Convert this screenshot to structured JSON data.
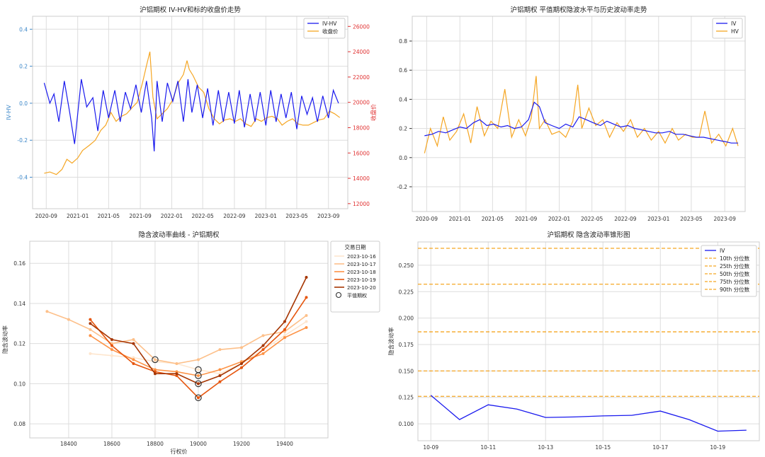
{
  "chart_data": [
    {
      "type": "line",
      "title": "沪铝期权 IV-HV和标的收盘价走势",
      "xlabel": "",
      "ylabel": "IV-HV",
      "y2label": "收盘价",
      "x_ticks": [
        "2020-09",
        "2021-01",
        "2021-05",
        "2021-09",
        "2022-01",
        "2022-05",
        "2022-09",
        "2023-01",
        "2023-05",
        "2023-09"
      ],
      "ylim": [
        -0.57,
        0.47
      ],
      "y_ticks": [
        "-0.4",
        "-0.2",
        "0.0",
        "0.2",
        "0.4"
      ],
      "y2lim": [
        11600,
        26800
      ],
      "y2_ticks": [
        "12000",
        "14000",
        "16000",
        "18000",
        "20000",
        "22000",
        "24000",
        "26000"
      ],
      "legend": "top-right",
      "grid": true,
      "colors": {
        "IV-HV": "#1a1aee",
        "收盘价": "#f5a623",
        "left_axis": "#3a86c8",
        "right_axis": "#e03030"
      },
      "series": [
        {
          "name": "IV-HV",
          "axis": "left",
          "x": [
            "2020-08-24",
            "2020-09-15",
            "2020-10-01",
            "2020-10-20",
            "2020-11-10",
            "2020-12-01",
            "2020-12-20",
            "2021-01-15",
            "2021-02-05",
            "2021-03-01",
            "2021-03-20",
            "2021-04-10",
            "2021-05-01",
            "2021-05-25",
            "2021-06-15",
            "2021-07-05",
            "2021-07-25",
            "2021-08-15",
            "2021-09-05",
            "2021-09-25",
            "2021-10-15",
            "2021-10-25",
            "2021-11-05",
            "2021-11-25",
            "2021-12-15",
            "2022-01-05",
            "2022-01-25",
            "2022-02-15",
            "2022-03-05",
            "2022-03-20",
            "2022-04-10",
            "2022-05-01",
            "2022-05-20",
            "2022-06-10",
            "2022-07-01",
            "2022-07-20",
            "2022-08-10",
            "2022-09-01",
            "2022-09-20",
            "2022-10-10",
            "2022-11-01",
            "2022-11-20",
            "2022-12-10",
            "2023-01-01",
            "2023-01-20",
            "2023-02-10",
            "2023-03-01",
            "2023-03-20",
            "2023-04-10",
            "2023-05-01",
            "2023-05-20",
            "2023-06-10",
            "2023-07-01",
            "2023-07-20",
            "2023-08-10",
            "2023-09-01",
            "2023-09-20",
            "2023-10-10"
          ],
          "values": [
            0.11,
            0.0,
            0.05,
            -0.1,
            0.12,
            -0.05,
            -0.22,
            0.13,
            -0.02,
            0.03,
            -0.15,
            0.07,
            -0.08,
            0.07,
            -0.1,
            0.06,
            -0.03,
            0.1,
            -0.05,
            0.12,
            -0.08,
            -0.26,
            0.12,
            -0.1,
            0.11,
            0.01,
            0.12,
            -0.1,
            0.13,
            -0.05,
            0.1,
            -0.08,
            0.08,
            -0.12,
            0.07,
            -0.1,
            0.06,
            -0.11,
            0.07,
            -0.13,
            0.05,
            -0.1,
            0.06,
            -0.12,
            0.07,
            -0.1,
            0.05,
            -0.08,
            0.06,
            -0.14,
            0.04,
            -0.06,
            0.03,
            -0.1,
            0.04,
            -0.08,
            0.07,
            0.0
          ]
        },
        {
          "name": "收盘价",
          "axis": "right",
          "x": [
            "2020-08-24",
            "2020-09-15",
            "2020-10-10",
            "2020-11-01",
            "2020-11-20",
            "2020-12-10",
            "2021-01-01",
            "2021-01-20",
            "2021-02-15",
            "2021-03-10",
            "2021-04-01",
            "2021-04-20",
            "2021-05-10",
            "2021-05-30",
            "2021-06-20",
            "2021-07-10",
            "2021-08-01",
            "2021-08-20",
            "2021-09-10",
            "2021-09-25",
            "2021-10-08",
            "2021-10-20",
            "2021-11-05",
            "2021-11-25",
            "2021-12-15",
            "2022-01-05",
            "2022-01-25",
            "2022-02-15",
            "2022-03-01",
            "2022-03-10",
            "2022-03-25",
            "2022-04-15",
            "2022-05-05",
            "2022-05-25",
            "2022-06-15",
            "2022-07-05",
            "2022-07-25",
            "2022-08-15",
            "2022-09-05",
            "2022-09-25",
            "2022-10-15",
            "2022-11-05",
            "2022-11-25",
            "2022-12-15",
            "2023-01-05",
            "2023-01-25",
            "2023-02-15",
            "2023-03-05",
            "2023-03-25",
            "2023-04-15",
            "2023-05-05",
            "2023-05-25",
            "2023-06-15",
            "2023-07-05",
            "2023-07-25",
            "2023-08-15",
            "2023-09-05",
            "2023-09-25",
            "2023-10-15"
          ],
          "values": [
            14400,
            14500,
            14300,
            14700,
            15500,
            15200,
            15600,
            16200,
            16600,
            17000,
            17800,
            18200,
            19200,
            18500,
            18900,
            19100,
            19600,
            20000,
            21600,
            22900,
            24000,
            20400,
            18700,
            19100,
            19500,
            20200,
            21500,
            22200,
            23300,
            22600,
            22100,
            21200,
            20800,
            19500,
            18700,
            18300,
            18600,
            18700,
            18500,
            18700,
            18300,
            18100,
            18700,
            18500,
            18800,
            18900,
            18700,
            18200,
            18500,
            18700,
            18300,
            18200,
            18200,
            18400,
            18600,
            18700,
            19300,
            19100,
            18800
          ]
        }
      ]
    },
    {
      "type": "line",
      "title": "沪铝期权 平值期权隐波水平与历史波动率走势",
      "xlabel": "",
      "ylabel": "",
      "x_ticks": [
        "2020-09",
        "2021-01",
        "2021-05",
        "2021-09",
        "2022-01",
        "2022-05",
        "2022-09",
        "2023-01",
        "2023-05",
        "2023-09"
      ],
      "ylim": [
        -0.37,
        0.97
      ],
      "y_ticks": [
        "-0.2",
        "0.0",
        "0.2",
        "0.4",
        "0.6",
        "0.8"
      ],
      "legend": "top-right",
      "grid": true,
      "colors": {
        "IV": "#1a1aee",
        "HV": "#f5a623"
      },
      "series": [
        {
          "name": "IV",
          "x": [
            "2020-08-24",
            "2020-09-20",
            "2020-10-15",
            "2020-11-10",
            "2020-12-05",
            "2021-01-01",
            "2021-01-25",
            "2021-02-20",
            "2021-03-15",
            "2021-04-10",
            "2021-05-05",
            "2021-06-01",
            "2021-06-25",
            "2021-07-20",
            "2021-08-15",
            "2021-09-10",
            "2021-10-01",
            "2021-10-20",
            "2021-11-10",
            "2021-12-05",
            "2022-01-01",
            "2022-01-25",
            "2022-02-20",
            "2022-03-15",
            "2022-04-10",
            "2022-05-05",
            "2022-06-01",
            "2022-06-25",
            "2022-07-20",
            "2022-08-15",
            "2022-09-10",
            "2022-10-05",
            "2022-11-01",
            "2022-11-25",
            "2022-12-20",
            "2023-01-15",
            "2023-02-10",
            "2023-03-05",
            "2023-04-01",
            "2023-04-25",
            "2023-05-20",
            "2023-06-15",
            "2023-07-10",
            "2023-08-05",
            "2023-09-01",
            "2023-09-25",
            "2023-10-20"
          ],
          "values": [
            0.15,
            0.16,
            0.18,
            0.17,
            0.19,
            0.21,
            0.2,
            0.24,
            0.26,
            0.22,
            0.23,
            0.21,
            0.22,
            0.2,
            0.21,
            0.26,
            0.38,
            0.35,
            0.24,
            0.22,
            0.2,
            0.23,
            0.21,
            0.28,
            0.26,
            0.24,
            0.22,
            0.25,
            0.23,
            0.21,
            0.22,
            0.2,
            0.19,
            0.18,
            0.17,
            0.17,
            0.18,
            0.16,
            0.16,
            0.15,
            0.14,
            0.14,
            0.13,
            0.12,
            0.11,
            0.1,
            0.1
          ]
        },
        {
          "name": "HV",
          "x": [
            "2020-08-24",
            "2020-09-15",
            "2020-10-10",
            "2020-11-01",
            "2020-11-25",
            "2020-12-20",
            "2021-01-15",
            "2021-02-10",
            "2021-03-05",
            "2021-04-01",
            "2021-04-25",
            "2021-05-20",
            "2021-06-15",
            "2021-07-10",
            "2021-08-05",
            "2021-08-30",
            "2021-09-20",
            "2021-10-08",
            "2021-10-20",
            "2021-11-10",
            "2021-12-05",
            "2022-01-01",
            "2022-01-25",
            "2022-02-20",
            "2022-03-10",
            "2022-03-25",
            "2022-04-20",
            "2022-05-15",
            "2022-06-10",
            "2022-07-05",
            "2022-08-01",
            "2022-08-25",
            "2022-09-20",
            "2022-10-15",
            "2022-11-10",
            "2022-12-05",
            "2023-01-01",
            "2023-01-25",
            "2023-02-20",
            "2023-03-15",
            "2023-04-10",
            "2023-05-05",
            "2023-05-30",
            "2023-06-20",
            "2023-07-15",
            "2023-08-10",
            "2023-09-05",
            "2023-09-30",
            "2023-10-20"
          ],
          "values": [
            0.03,
            0.2,
            0.08,
            0.28,
            0.12,
            0.18,
            0.3,
            0.1,
            0.35,
            0.15,
            0.25,
            0.2,
            0.47,
            0.14,
            0.26,
            0.15,
            0.27,
            0.56,
            0.2,
            0.26,
            0.16,
            0.18,
            0.14,
            0.25,
            0.5,
            0.2,
            0.34,
            0.22,
            0.26,
            0.14,
            0.24,
            0.18,
            0.26,
            0.14,
            0.2,
            0.12,
            0.18,
            0.1,
            0.2,
            0.12,
            0.16,
            0.14,
            0.14,
            0.32,
            0.1,
            0.16,
            0.08,
            0.2,
            0.08
          ]
        }
      ]
    },
    {
      "type": "line",
      "title": "隐含波动率曲线 - 沪铝期权",
      "xlabel": "行权价",
      "ylabel": "隐含波动率",
      "xlim": [
        18220,
        19600
      ],
      "x_ticks": [
        "18400",
        "18600",
        "18800",
        "19000",
        "19200",
        "19400"
      ],
      "ylim": [
        0.073,
        0.171
      ],
      "y_ticks": [
        "0.08",
        "0.10",
        "0.12",
        "0.14",
        "0.16"
      ],
      "legend_title": "交易日期",
      "legend": "right-outside",
      "grid": true,
      "atm_label": "平值期权",
      "series": [
        {
          "name": "2023-10-16",
          "color": "#fee6ce",
          "x": [
            18500,
            18600,
            18700,
            18800,
            18900,
            19000,
            19100,
            19200,
            19300,
            19400,
            19500
          ],
          "values": [
            0.115,
            0.114,
            0.113,
            0.111,
            0.11,
            0.107,
            0.105,
            0.11,
            0.117,
            0.124,
            0.131
          ]
        },
        {
          "name": "2023-10-17",
          "color": "#fdc08a",
          "x": [
            18300,
            18400,
            18500,
            18600,
            18700,
            18800,
            18900,
            19000,
            19100,
            19200,
            19300,
            19400,
            19500
          ],
          "values": [
            0.136,
            0.132,
            0.127,
            0.12,
            0.122,
            0.112,
            0.11,
            0.112,
            0.117,
            0.118,
            0.124,
            0.126,
            0.134
          ]
        },
        {
          "name": "2023-10-18",
          "color": "#fd9346",
          "x": [
            18500,
            18600,
            18700,
            18800,
            18900,
            19000,
            19100,
            19200,
            19300,
            19400,
            19500
          ],
          "values": [
            0.124,
            0.117,
            0.112,
            0.107,
            0.106,
            0.104,
            0.107,
            0.111,
            0.115,
            0.123,
            0.128
          ]
        },
        {
          "name": "2023-10-19",
          "color": "#e6550d",
          "x": [
            18500,
            18600,
            18700,
            18800,
            18900,
            19000,
            19100,
            19200,
            19300,
            19400,
            19500
          ],
          "values": [
            0.132,
            0.119,
            0.11,
            0.106,
            0.104,
            0.093,
            0.101,
            0.108,
            0.117,
            0.127,
            0.143
          ]
        },
        {
          "name": "2023-10-20",
          "color": "#a63603",
          "x": [
            18500,
            18600,
            18700,
            18800,
            18900,
            19000,
            19100,
            19200,
            19300,
            19400,
            19500
          ],
          "values": [
            0.13,
            0.122,
            0.12,
            0.105,
            0.105,
            0.1,
            0.104,
            0.11,
            0.119,
            0.131,
            0.153
          ]
        }
      ],
      "atm_points": [
        {
          "x": 18800,
          "y": 0.112
        },
        {
          "x": 19000,
          "y": 0.107
        },
        {
          "x": 19000,
          "y": 0.104
        },
        {
          "x": 19000,
          "y": 0.1
        },
        {
          "x": 19000,
          "y": 0.093
        }
      ]
    },
    {
      "type": "line",
      "title": "沪铝期权 隐含波动率锥形图",
      "xlabel": "",
      "ylabel": "隐含波动率",
      "x": [
        "10-09",
        "10-10",
        "10-11",
        "10-12",
        "10-13",
        "10-14",
        "10-15",
        "10-16",
        "10-17",
        "10-18",
        "10-19",
        "10-20"
      ],
      "x_ticks": [
        "10-09",
        "10-11",
        "10-13",
        "10-15",
        "10-17",
        "10-19"
      ],
      "ylim": [
        0.084,
        0.272
      ],
      "y_ticks": [
        "0.100",
        "0.125",
        "0.150",
        "0.175",
        "0.200",
        "0.225",
        "0.250"
      ],
      "legend": "top-right",
      "grid": true,
      "series": [
        {
          "name": "IV",
          "color": "#1a1aee",
          "values": [
            0.127,
            0.104,
            0.118,
            0.114,
            0.106,
            0.1065,
            0.1075,
            0.108,
            0.112,
            0.104,
            0.093,
            0.094
          ]
        }
      ],
      "percentiles": [
        {
          "name": "10th 分位数",
          "value": 0.126
        },
        {
          "name": "25th 分位数",
          "value": 0.15
        },
        {
          "name": "50th 分位数",
          "value": 0.187
        },
        {
          "name": "75th 分位数",
          "value": 0.232
        },
        {
          "name": "90th 分位数",
          "value": 0.266
        }
      ],
      "percentile_color": "#f5a623"
    }
  ]
}
